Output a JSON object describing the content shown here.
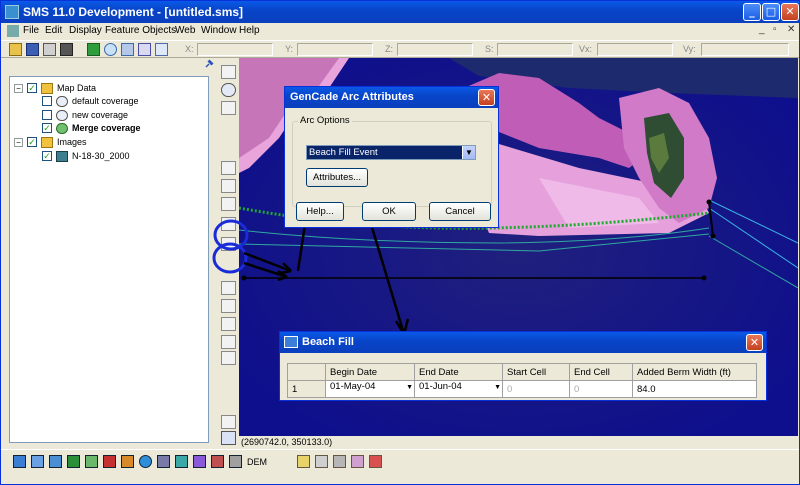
{
  "window": {
    "title": "SMS 11.0 Development - [untitled.sms]"
  },
  "menu": [
    "File",
    "Edit",
    "Display",
    "Feature Objects",
    "Web",
    "Window",
    "Help"
  ],
  "coords": {
    "labels": [
      "X:",
      "Y:",
      "Z:",
      "S:",
      "Vx:",
      "Vy:"
    ]
  },
  "tree": {
    "root": "Map Data",
    "coverages": [
      "default coverage",
      "new coverage",
      "Merge coverage"
    ],
    "images_label": "Images",
    "image": "N-18-30_2000"
  },
  "status": {
    "coords": "(2690742.0, 350133.0)"
  },
  "arc_dialog": {
    "title": "GenCade Arc Attributes",
    "group_label": "Arc Options",
    "selected_option": "Beach Fill Event",
    "attributes_button": "Attributes...",
    "help_button": "Help...",
    "ok_button": "OK",
    "cancel_button": "Cancel"
  },
  "beach_fill": {
    "title": "Beach Fill",
    "columns": [
      "Begin Date",
      "End Date",
      "Start Cell",
      "End Cell",
      "Added Berm Width (ft)"
    ],
    "rows": [
      {
        "index": "1",
        "begin_date": "01-May-04",
        "end_date": "01-Jun-04",
        "start_cell": "0",
        "end_cell": "0",
        "berm_width": "84.0"
      }
    ]
  },
  "status_bottom": {
    "dem_label": "DEM"
  },
  "colors": {
    "titlebar": "#0845c9",
    "map_background": "#12139a",
    "annotation": "#1a2bd8"
  }
}
